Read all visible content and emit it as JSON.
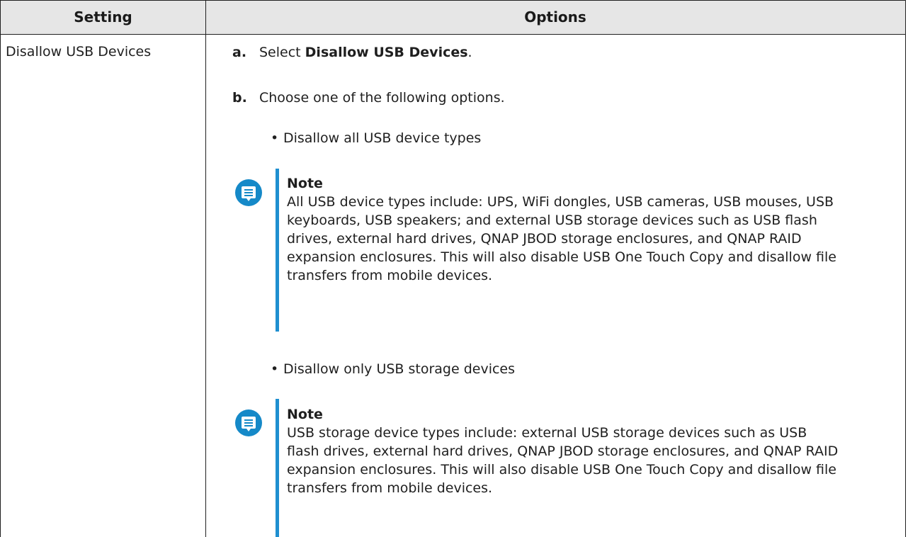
{
  "header": {
    "setting": "Setting",
    "options": "Options"
  },
  "row": {
    "setting": "Disallow USB Devices",
    "step_a": {
      "label": "a.",
      "prefix": "Select ",
      "bold": "Disallow USB Devices",
      "suffix": "."
    },
    "step_b": {
      "label": "b.",
      "text": "Choose one of the following options."
    },
    "option1": {
      "bullet": "•",
      "text": "Disallow all USB device types"
    },
    "note1": {
      "icon": "note-icon",
      "title": "Note",
      "text": "All USB device types include: UPS, WiFi dongles, USB cameras, USB mouses, USB keyboards, USB speakers; and external USB storage devices such as USB flash drives, external hard drives, QNAP JBOD storage enclosures, and QNAP RAID expansion enclosures. This will also disable USB One Touch Copy and disallow file transfers from mobile devices."
    },
    "option2": {
      "bullet": "•",
      "text": "Disallow only USB storage devices"
    },
    "note2": {
      "icon": "note-icon",
      "title": "Note",
      "text": "USB storage device types include: external USB storage devices such as USB flash drives, external hard drives, QNAP JBOD storage enclosures, and QNAP RAID expansion enclosures. This will also disable USB One Touch Copy and disallow file transfers from mobile devices."
    }
  },
  "colors": {
    "header_bg": "#e6e6e6",
    "note_accent": "#1f8fd0",
    "icon_bg": "#1589c8"
  }
}
